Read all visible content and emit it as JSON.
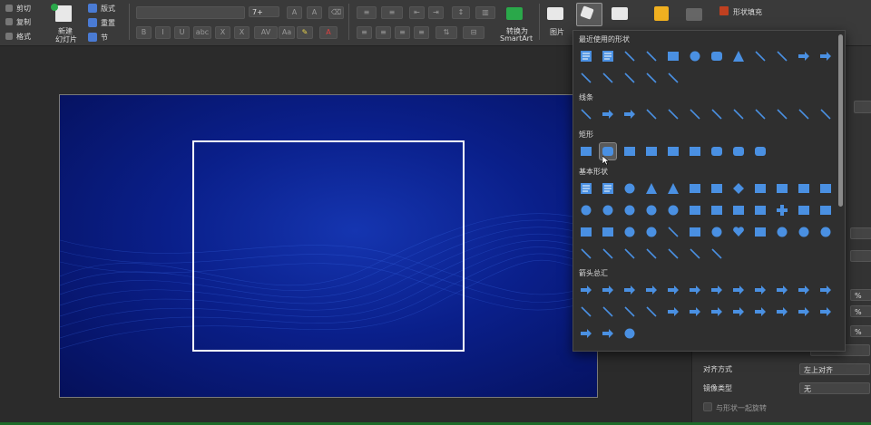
{
  "ribbon": {
    "cut": "剪切",
    "copy": "复制",
    "format": "格式",
    "new_slide_1": "新建",
    "new_slide_2": "幻灯片",
    "layout": "版式",
    "reset": "重置",
    "section": "节",
    "font_size": "7+",
    "convert_1": "转换为",
    "convert_2": "SmartArt",
    "picture": "图片",
    "shape_fill": "形状填充"
  },
  "shapes_menu": {
    "recent_title": "最近使用的形状",
    "lines_title": "线条",
    "rect_title": "矩形",
    "basic_title": "基本形状",
    "arrows_title": "箭头总汇",
    "recent_icons": [
      "text-box",
      "vertical-text-box",
      "line",
      "arrow-line",
      "rectangle",
      "oval",
      "rounded-rectangle",
      "triangle",
      "elbow-connector",
      "elbow-connector-2",
      "right-arrow",
      "down-arrow",
      "freeform",
      "scribble",
      "curve",
      "curve-2",
      "brace-left"
    ],
    "line_icons": [
      "line",
      "arrow",
      "double-arrow",
      "elbow",
      "elbow-arrow",
      "elbow-double-arrow",
      "curved",
      "curved-arrow",
      "curved-double-arrow",
      "curve",
      "freeform",
      "scribble"
    ],
    "rect_icons": [
      "rectangle",
      "rounded-rectangle",
      "snip-single-corner",
      "snip-same-side",
      "snip-diagonal",
      "snip-round",
      "round-single-corner",
      "round-same-side",
      "round-diagonal"
    ],
    "basic_icons": [
      "text-box",
      "vertical-text-box",
      "oval",
      "triangle",
      "right-triangle",
      "parallelogram",
      "trapezoid",
      "diamond",
      "pentagon",
      "hexagon",
      "heptagon",
      "octagon",
      "decagon",
      "dodecagon",
      "pie",
      "chord",
      "teardrop",
      "frame",
      "half-frame",
      "l-shape",
      "diagonal-stripe",
      "cross",
      "plaque",
      "can",
      "cube",
      "bevel",
      "donut",
      "no-symbol",
      "block-arc",
      "folded-corner",
      "smiley",
      "heart",
      "lightning",
      "sun",
      "moon",
      "cloud",
      "arc",
      "double-bracket",
      "double-brace",
      "left-bracket",
      "right-bracket",
      "left-brace",
      "right-brace"
    ],
    "arrow_icons": [
      "right-arrow",
      "left-arrow",
      "up-arrow",
      "down-arrow",
      "left-right-arrow",
      "up-down-arrow",
      "quad-arrow",
      "left-right-up-arrow",
      "bent-arrow",
      "u-turn-arrow",
      "left-up-arrow",
      "bent-up-arrow",
      "curved-right-arrow",
      "curved-left-arrow",
      "curved-up-arrow",
      "curved-down-arrow",
      "striped-right-arrow",
      "notched-right-arrow",
      "pentagon-arrow",
      "chevron",
      "right-arrow-callout",
      "down-arrow-callout",
      "left-arrow-callout",
      "up-arrow-callout",
      "left-right-arrow-callout",
      "quad-arrow-callout",
      "circular-arrow"
    ],
    "selected": "rounded-rectangle"
  },
  "right_panel": {
    "alignment_label": "对齐方式",
    "alignment_value": "左上对齐",
    "mirror_label": "镜像类型",
    "mirror_value": "无",
    "rotate_label": "与形状一起旋转",
    "percent_1": "%",
    "percent_2": "%",
    "percent_3": "%"
  },
  "colors": {
    "accent": "#4a90e2",
    "ribbon": "#3a3a3a",
    "slide_bg": "#0a1f8a"
  }
}
